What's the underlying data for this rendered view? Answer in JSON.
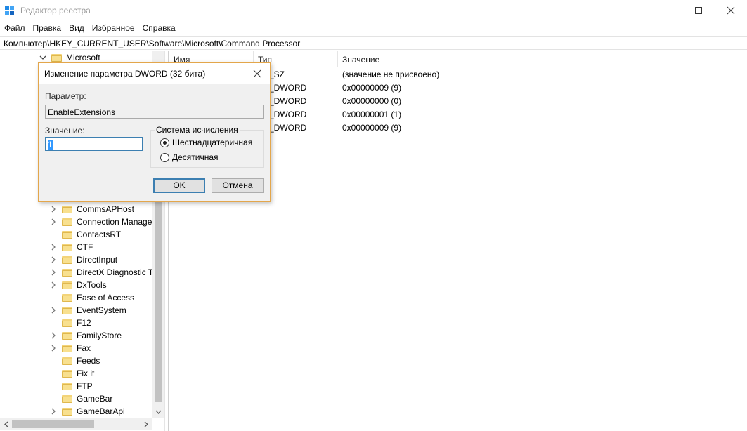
{
  "window": {
    "title": "Редактор реестра",
    "buttons": [
      "minimize-icon",
      "maximize-icon",
      "close-icon"
    ]
  },
  "menu": [
    "Файл",
    "Правка",
    "Вид",
    "Избранное",
    "Справка"
  ],
  "address": "Компьютер\\HKEY_CURRENT_USER\\Software\\Microsoft\\Command Processor",
  "tree": {
    "parent": "Microsoft",
    "items": [
      "CommsAPHost",
      "Connection Manager",
      "ContactsRT",
      "CTF",
      "DirectInput",
      "DirectX Diagnostic Tool",
      "DxTools",
      "Ease of Access",
      "EventSystem",
      "F12",
      "FamilyStore",
      "Fax",
      "Feeds",
      "Fix it",
      "FTP",
      "GameBar",
      "GameBarApi"
    ],
    "expandable": [
      true,
      true,
      false,
      true,
      true,
      true,
      true,
      false,
      true,
      false,
      true,
      true,
      false,
      false,
      false,
      false,
      true
    ]
  },
  "list": {
    "columns": [
      "Имя",
      "Тип",
      "Значение"
    ],
    "rows": [
      {
        "type": "REG_SZ",
        "value": "(значение не присвоено)"
      },
      {
        "type": "REG_DWORD",
        "value": "0x00000009 (9)"
      },
      {
        "type": "REG_DWORD",
        "value": "0x00000000 (0)"
      },
      {
        "type": "REG_DWORD",
        "value": "0x00000001 (1)"
      },
      {
        "type": "REG_DWORD",
        "value": "0x00000009 (9)"
      }
    ],
    "visible_type_fragments": [
      "_SZ",
      "_DWORD",
      "_DWORD",
      "_DWORD",
      "_DWORD"
    ]
  },
  "dialog": {
    "title": "Изменение параметра DWORD (32 бита)",
    "param_label": "Параметр:",
    "param_value": "EnableExtensions",
    "value_label": "Значение:",
    "value": "1",
    "base_group": "Система исчисления",
    "base_options": [
      "Шестнадцатеричная",
      "Десятичная"
    ],
    "base_selected": "Шестнадцатеричная",
    "ok": "OK",
    "cancel": "Отмена"
  }
}
